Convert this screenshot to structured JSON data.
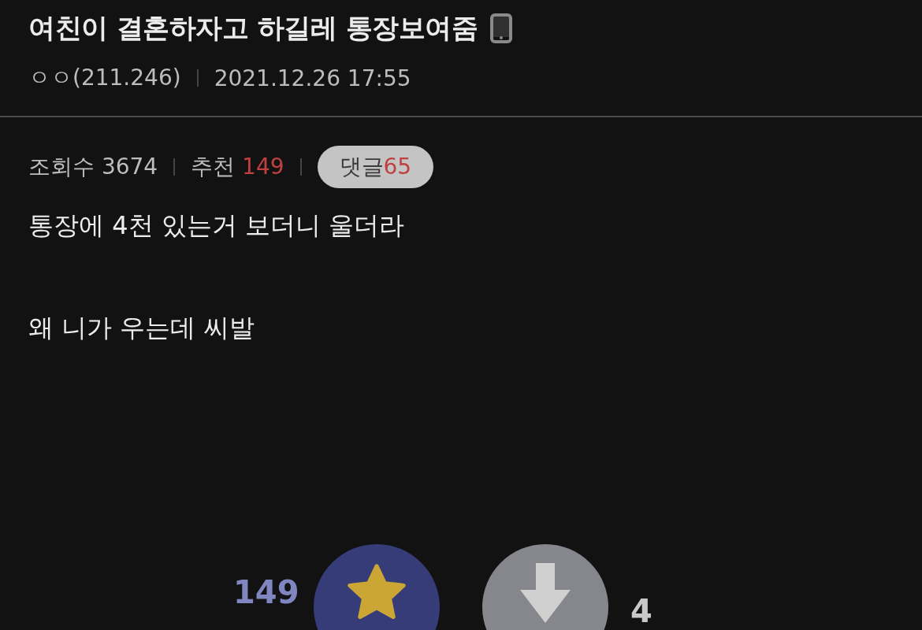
{
  "post": {
    "title": "여친이 결혼하자고 하길레 통장보여줌",
    "author": "ㅇㅇ(211.246)",
    "date": "2021.12.26 17:55"
  },
  "stats": {
    "views_label": "조회수",
    "views": "3674",
    "recommend_label": "추천",
    "recommend": "149",
    "comments_label": "댓글",
    "comments": "65"
  },
  "body": [
    "통장에 4천 있는거 보더니 울더라",
    "왜 니가 우는데 씨발"
  ],
  "votes": {
    "up_count": "149",
    "down_count": "4"
  }
}
